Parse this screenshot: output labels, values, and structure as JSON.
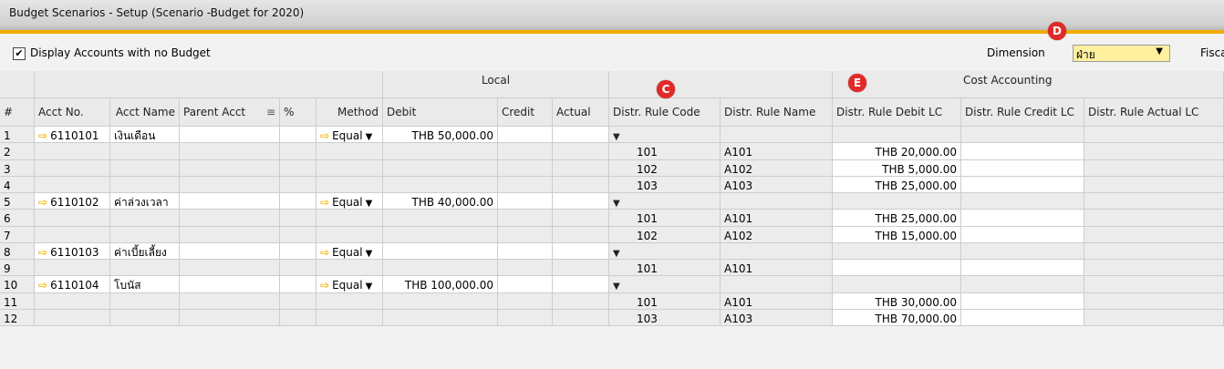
{
  "window": {
    "title": "Budget Scenarios - Setup (Scenario -Budget for 2020)"
  },
  "toolbar": {
    "display_accounts_label": "Display Accounts with no Budget",
    "display_accounts_checked": true,
    "dimension_label": "Dimension",
    "dimension_value": "ฝ่าย",
    "fiscal_label": "Fisca"
  },
  "badges": {
    "c": "C",
    "d": "D",
    "e": "E"
  },
  "colors": {
    "accent": "#f0ab00",
    "badge": "#e02a2a",
    "dimension_bg": "#fff0a0"
  },
  "grid": {
    "sections": {
      "local": "Local",
      "cost_accounting": "Cost Accounting"
    },
    "columns": [
      "#",
      "Acct No.",
      "Acct Name",
      "Parent Acct",
      "%",
      "Method",
      "Debit",
      "Credit",
      "Actual",
      "Distr. Rule Code",
      "Distr. Rule Name",
      "Distr. Rule Debit LC",
      "Distr. Rule Credit LC",
      "Distr. Rule Actual LC"
    ],
    "rows": [
      {
        "num": "1",
        "acct_no": "6110101",
        "acct_name": "เงินเดือน",
        "method": "Equal",
        "debit": "THB 50,000.00",
        "rule_code": "",
        "rule_name": "",
        "rule_debit": ""
      },
      {
        "num": "2",
        "acct_no": "",
        "acct_name": "",
        "method": "",
        "debit": "",
        "rule_code": "101",
        "rule_name": "A101",
        "rule_debit": "THB 20,000.00"
      },
      {
        "num": "3",
        "acct_no": "",
        "acct_name": "",
        "method": "",
        "debit": "",
        "rule_code": "102",
        "rule_name": "A102",
        "rule_debit": "THB 5,000.00"
      },
      {
        "num": "4",
        "acct_no": "",
        "acct_name": "",
        "method": "",
        "debit": "",
        "rule_code": "103",
        "rule_name": "A103",
        "rule_debit": "THB 25,000.00"
      },
      {
        "num": "5",
        "acct_no": "6110102",
        "acct_name": "ค่าล่วงเวลา",
        "method": "Equal",
        "debit": "THB 40,000.00",
        "rule_code": "",
        "rule_name": "",
        "rule_debit": ""
      },
      {
        "num": "6",
        "acct_no": "",
        "acct_name": "",
        "method": "",
        "debit": "",
        "rule_code": "101",
        "rule_name": "A101",
        "rule_debit": "THB 25,000.00"
      },
      {
        "num": "7",
        "acct_no": "",
        "acct_name": "",
        "method": "",
        "debit": "",
        "rule_code": "102",
        "rule_name": "A102",
        "rule_debit": "THB 15,000.00"
      },
      {
        "num": "8",
        "acct_no": "6110103",
        "acct_name": "ค่าเบี้ยเลี้ยง",
        "method": "Equal",
        "debit": "",
        "rule_code": "",
        "rule_name": "",
        "rule_debit": ""
      },
      {
        "num": "9",
        "acct_no": "",
        "acct_name": "",
        "method": "",
        "debit": "",
        "rule_code": "101",
        "rule_name": "A101",
        "rule_debit": ""
      },
      {
        "num": "10",
        "acct_no": "6110104",
        "acct_name": "โบนัส",
        "method": "Equal",
        "debit": "THB 100,000.00",
        "rule_code": "",
        "rule_name": "",
        "rule_debit": ""
      },
      {
        "num": "11",
        "acct_no": "",
        "acct_name": "",
        "method": "",
        "debit": "",
        "rule_code": "101",
        "rule_name": "A101",
        "rule_debit": "THB 30,000.00"
      },
      {
        "num": "12",
        "acct_no": "",
        "acct_name": "",
        "method": "",
        "debit": "",
        "rule_code": "103",
        "rule_name": "A103",
        "rule_debit": "THB 70,000.00"
      }
    ]
  }
}
